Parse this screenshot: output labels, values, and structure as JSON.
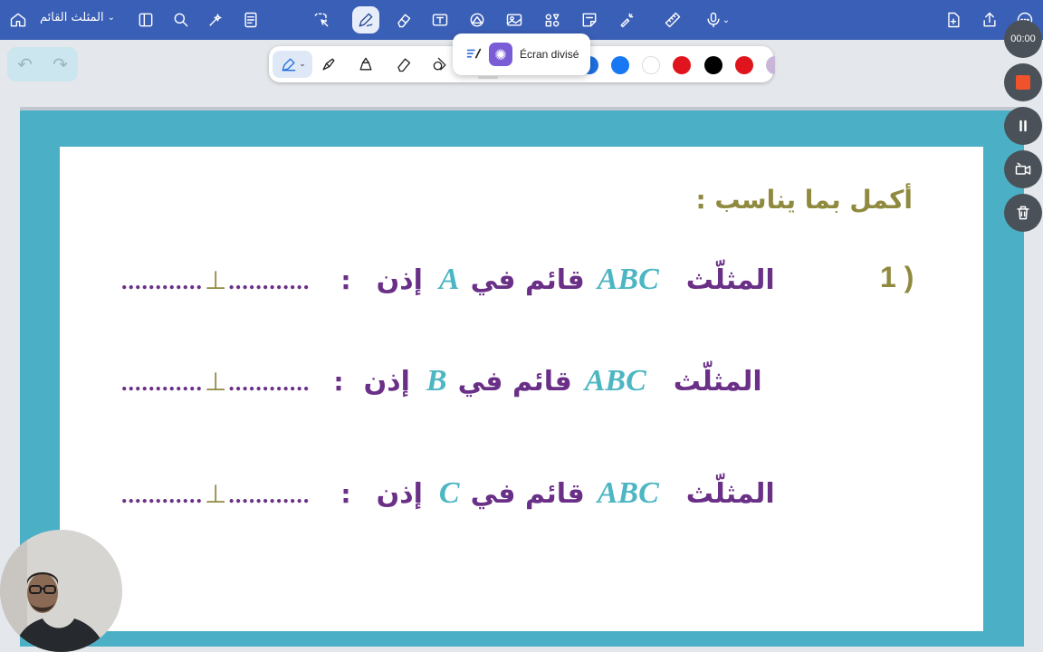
{
  "topbar": {
    "doc_title": "المثلث القائم",
    "icons": [
      "home-icon",
      "sidebar-icon",
      "search-icon",
      "magic-icon",
      "notes-icon",
      "lasso-icon",
      "pen-icon",
      "eraser-icon",
      "textbox-icon",
      "shapes-icon",
      "image-icon",
      "elements-icon",
      "sticky-note-icon",
      "laser-icon",
      "ruler-icon",
      "mic-icon",
      "add-page-icon",
      "share-icon",
      "more-icon"
    ]
  },
  "undo_redo": {
    "undo": "↶",
    "redo": "↷"
  },
  "pen_toolbar": {
    "tools": [
      "fountain-pen",
      "highlighter",
      "pencil",
      "eraser-tool",
      "shape-tool"
    ],
    "colors": [
      "#1f6fe0",
      "#1877f2",
      "#ffffff",
      "#e0141c",
      "#000000",
      "#e0141c",
      "#c8b6d8"
    ]
  },
  "split_screen_popup": {
    "label": "Écran divisé"
  },
  "slide": {
    "heading": "أكمل بما يناسب :",
    "item_number": "1 )",
    "lines": [
      {
        "label_triangle": "المثلّث",
        "abc": "ABC",
        "qaim": "قائم في",
        "vertex": "A",
        "idhan": "إذن",
        "colon": ":",
        "blank_right": "............",
        "perp": "⊥",
        "blank_left": "............"
      },
      {
        "label_triangle": "المثلّث",
        "abc": "ABC",
        "qaim": "قائم في",
        "vertex": "B",
        "idhan": "إذن",
        "colon": ":",
        "blank_right": "............",
        "perp": "⊥",
        "blank_left": "............"
      },
      {
        "label_triangle": "المثلّث",
        "abc": "ABC",
        "qaim": "قائم في",
        "vertex": "C",
        "idhan": "إذن",
        "colon": ":",
        "blank_right": "............",
        "perp": "⊥",
        "blank_left": "............"
      }
    ]
  },
  "recording": {
    "timer": "00:00"
  }
}
